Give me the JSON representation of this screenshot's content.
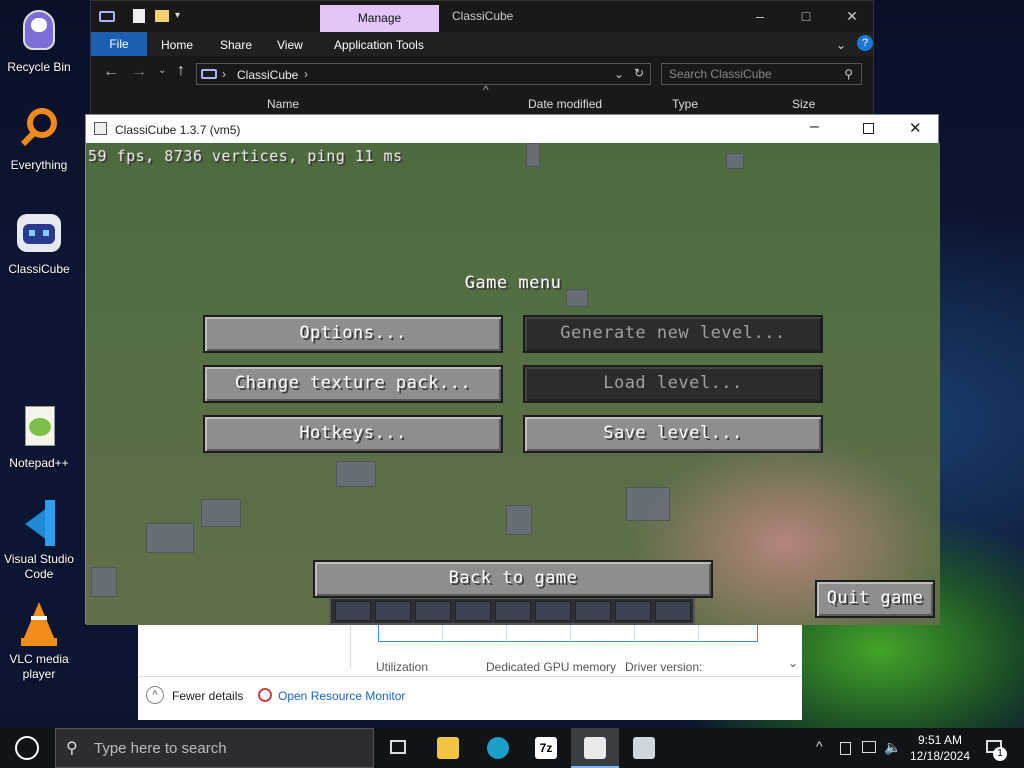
{
  "desktop": {
    "icons": [
      {
        "label": "Recycle Bin",
        "icon": "recycle-bin-icon"
      },
      {
        "label": "Everything",
        "icon": "everything-search-icon"
      },
      {
        "label": "ClassiCube",
        "icon": "classicube-icon"
      },
      {
        "label": "Notepad++",
        "icon": "notepadpp-icon"
      },
      {
        "label": "Visual Studio Code",
        "icon": "vscode-icon"
      },
      {
        "label": "VLC media player",
        "icon": "vlc-icon"
      }
    ]
  },
  "explorer": {
    "context_tab": "Manage",
    "title": "ClassiCube",
    "ribbon": {
      "file": "File",
      "home": "Home",
      "share": "Share",
      "view": "View",
      "tools": "Application Tools"
    },
    "address": "ClassiCube",
    "search_placeholder": "Search ClassiCube",
    "columns": {
      "name": "Name",
      "date": "Date modified",
      "type": "Type",
      "size": "Size"
    }
  },
  "taskmgr": {
    "utilization": "Utilization",
    "gpu_memory": "Dedicated GPU memory",
    "driver": "Driver version:",
    "fewer_details": "Fewer details",
    "open_monitor": "Open Resource Monitor"
  },
  "classicube": {
    "window_title": "ClassiCube 1.3.7 (vm5)",
    "stats": "59 fps, 8736 vertices, ping 11 ms",
    "menu_title": "Game menu",
    "buttons": {
      "options": "Options...",
      "generate": "Generate new level...",
      "texture": "Change texture pack...",
      "load": "Load level...",
      "hotkeys": "Hotkeys...",
      "save": "Save level...",
      "back": "Back to game",
      "quit": "Quit game"
    }
  },
  "taskbar": {
    "search_placeholder": "Type here to search",
    "time": "9:51 AM",
    "date": "12/18/2024",
    "notification_count": "1",
    "apps": [
      "file-explorer-icon",
      "edge-icon",
      "7zip-icon",
      "classicube-icon",
      "remote-desktop-icon"
    ]
  },
  "colors": {
    "accent_blue": "#1a5fb4",
    "manage_tab": "#e3c6f6",
    "grass": "#556f44",
    "button_grey": "#8e8e8e"
  }
}
